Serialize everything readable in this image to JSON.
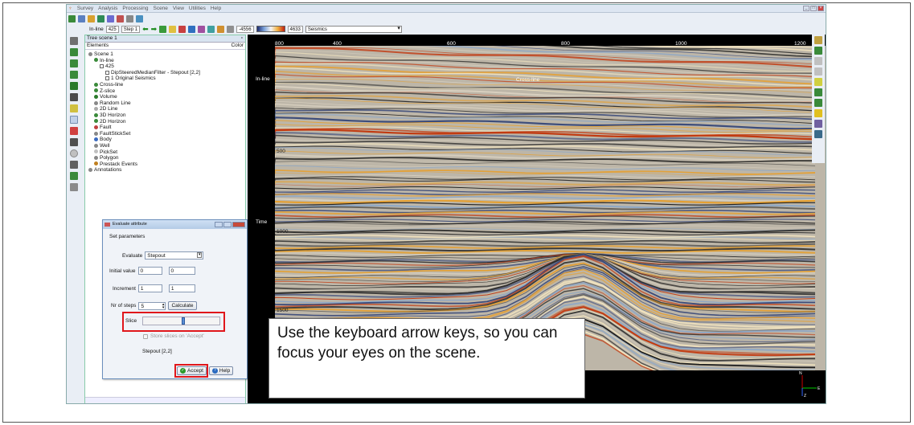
{
  "menu": {
    "items": [
      "Survey",
      "Analysis",
      "Processing",
      "Scene",
      "View",
      "Utilities",
      "Help"
    ]
  },
  "toolbar": {
    "inline_label": "In-line",
    "inline_value": "425",
    "step_value": "Step 1",
    "colorbar_min": "-4556",
    "colorbar_max": "4633",
    "attribute_select": "Seismics"
  },
  "tree": {
    "header": "Tree scene 1",
    "col_elements": "Elements",
    "col_color": "Color",
    "items": [
      {
        "label": "Scene 1",
        "indent": 0
      },
      {
        "label": "In-line",
        "indent": 1
      },
      {
        "label": "425",
        "indent": 2
      },
      {
        "label": "DipSteeredMedianFilter - Stepout [2,2]",
        "indent": 3
      },
      {
        "label": "1 Original Seismics",
        "indent": 3
      },
      {
        "label": "Cross-line",
        "indent": 1
      },
      {
        "label": "Z-slice",
        "indent": 1
      },
      {
        "label": "Volume",
        "indent": 1
      },
      {
        "label": "Random Line",
        "indent": 1
      },
      {
        "label": "2D Line",
        "indent": 1
      },
      {
        "label": "3D Horizon",
        "indent": 1
      },
      {
        "label": "2D Horizon",
        "indent": 1
      },
      {
        "label": "Fault",
        "indent": 1
      },
      {
        "label": "FaultStickSet",
        "indent": 1
      },
      {
        "label": "Body",
        "indent": 1
      },
      {
        "label": "Well",
        "indent": 1
      },
      {
        "label": "PickSet",
        "indent": 1
      },
      {
        "label": "Polygon",
        "indent": 1
      },
      {
        "label": "Prestack Events",
        "indent": 1
      },
      {
        "label": "Annotations",
        "indent": 0
      }
    ]
  },
  "viewer": {
    "inline_label": "In-line",
    "crossline_label": "Cross-line",
    "time_label": "Time",
    "x_ticks": [
      "800",
      "400",
      "600",
      "800",
      "1000",
      "1200"
    ],
    "y_ticks": [
      "500",
      "1000",
      "1500"
    ]
  },
  "dialog": {
    "title": "Evaluate attribute",
    "section": "Set parameters",
    "evaluate_label": "Evaluate",
    "evaluate_value": "Stepout",
    "initial_label": "Initial value",
    "initial_a": "0",
    "initial_b": "0",
    "increment_label": "Increment",
    "increment_a": "1",
    "increment_b": "1",
    "nsteps_label": "Nr of steps",
    "nsteps_value": "5",
    "calculate_label": "Calculate",
    "slice_label": "Slice",
    "store_label": "Store slices on 'Accept'",
    "result_label": "Stepout [2,2]",
    "accept_label": "Accept",
    "help_label": "Help"
  },
  "callout": {
    "text": "Use the keyboard arrow keys, so you can focus your eyes on the scene."
  },
  "axes": {
    "north": "N",
    "east": "E",
    "z": "Z"
  }
}
